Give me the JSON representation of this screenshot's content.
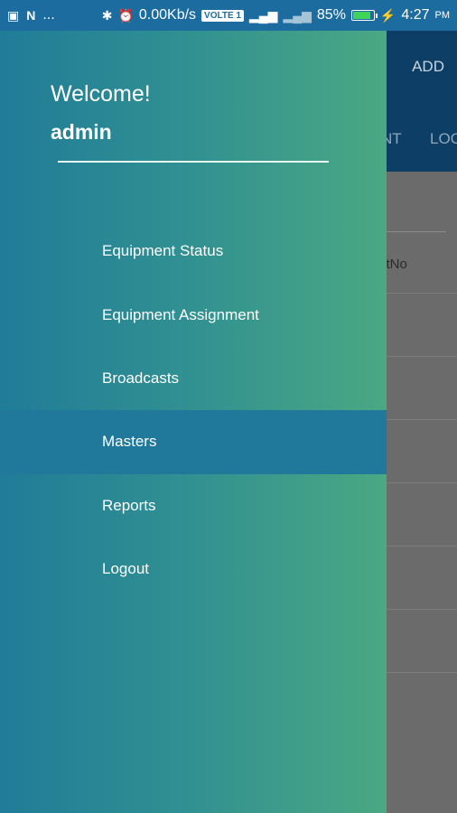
{
  "status_bar": {
    "net_speed": "0.00Kb/s",
    "volte": "VOLTE 1",
    "battery": "85%",
    "time": "4:27",
    "ampm": "PM",
    "dots": "..."
  },
  "app": {
    "add_label": "ADD",
    "tab1": "NT",
    "tab2": "LOC",
    "column_header": "ctNo"
  },
  "drawer": {
    "welcome": "Welcome!",
    "username": "admin",
    "items": [
      {
        "label": "Equipment Status"
      },
      {
        "label": "Equipment Assignment"
      },
      {
        "label": "Broadcasts"
      },
      {
        "label": "Masters"
      },
      {
        "label": "Reports"
      },
      {
        "label": "Logout"
      }
    ],
    "active_item": "Masters"
  },
  "colors": {
    "status_bar": "#1d6c9f",
    "drawer_start": "#207c98",
    "drawer_end": "#4aa883",
    "active_item": "#20799b",
    "appbar_dimmed": "#0d3f66"
  }
}
